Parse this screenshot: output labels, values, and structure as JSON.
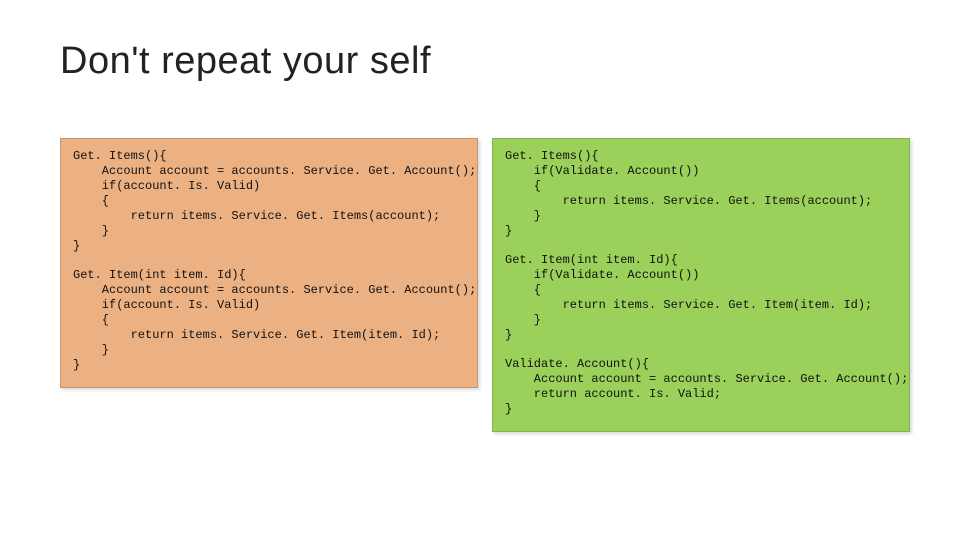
{
  "slide": {
    "title": "Don't repeat your self"
  },
  "left": {
    "block1": "Get. Items(){\n    Account account = accounts. Service. Get. Account();\n    if(account. Is. Valid)\n    {\n        return items. Service. Get. Items(account);\n    }\n}",
    "block2": "Get. Item(int item. Id){\n    Account account = accounts. Service. Get. Account();\n    if(account. Is. Valid)\n    {\n        return items. Service. Get. Item(item. Id);\n    }\n}"
  },
  "right": {
    "block1": "Get. Items(){\n    if(Validate. Account())\n    {\n        return items. Service. Get. Items(account);\n    }\n}",
    "block2": "Get. Item(int item. Id){\n    if(Validate. Account())\n    {\n        return items. Service. Get. Item(item. Id);\n    }\n}",
    "block3": "Validate. Account(){\n    Account account = accounts. Service. Get. Account();\n    return account. Is. Valid;\n}"
  }
}
